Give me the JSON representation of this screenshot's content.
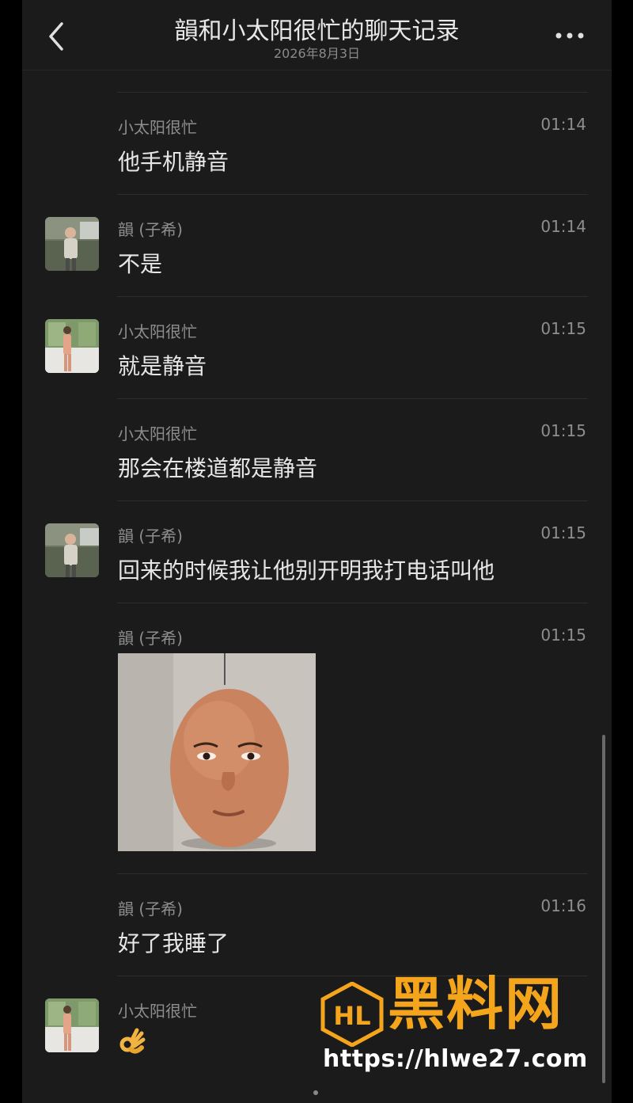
{
  "header": {
    "title": "韻和小太阳很忙的聊天记录",
    "date": "2026年8月3日",
    "back_icon": "chevron-left-icon",
    "more_icon": "more-dots-icon"
  },
  "messages": [
    {
      "sender": "小太阳很忙",
      "time": "01:14",
      "text": "他手机静音"
    },
    {
      "sender": "韻 (子希)",
      "time": "01:14",
      "text": "不是"
    },
    {
      "sender": "小太阳很忙",
      "time": "01:15",
      "text": "就是静音"
    },
    {
      "sender": "小太阳很忙",
      "time": "01:15",
      "text": "那会在楼道都是静音"
    },
    {
      "sender": "韻 (子希)",
      "time": "01:15",
      "text": "回来的时候我让他别开明我打电话叫他"
    },
    {
      "sender": "韻 (子希)",
      "time": "01:15",
      "sticker": "egg-face-sticker"
    },
    {
      "sender": "韻 (子希)",
      "time": "01:16",
      "text": "好了我睡了"
    },
    {
      "sender": "小太阳很忙",
      "time": "",
      "emoji": "ok-hand-emoji"
    }
  ],
  "watermark": {
    "logo": "HL",
    "brand": "黑料网",
    "url": "https://hlwe27.com"
  },
  "colors": {
    "background": "#1b1b1b",
    "text": "#e6e6e6",
    "meta": "#8e8e8e",
    "watermark_accent": "#f5a51b"
  }
}
